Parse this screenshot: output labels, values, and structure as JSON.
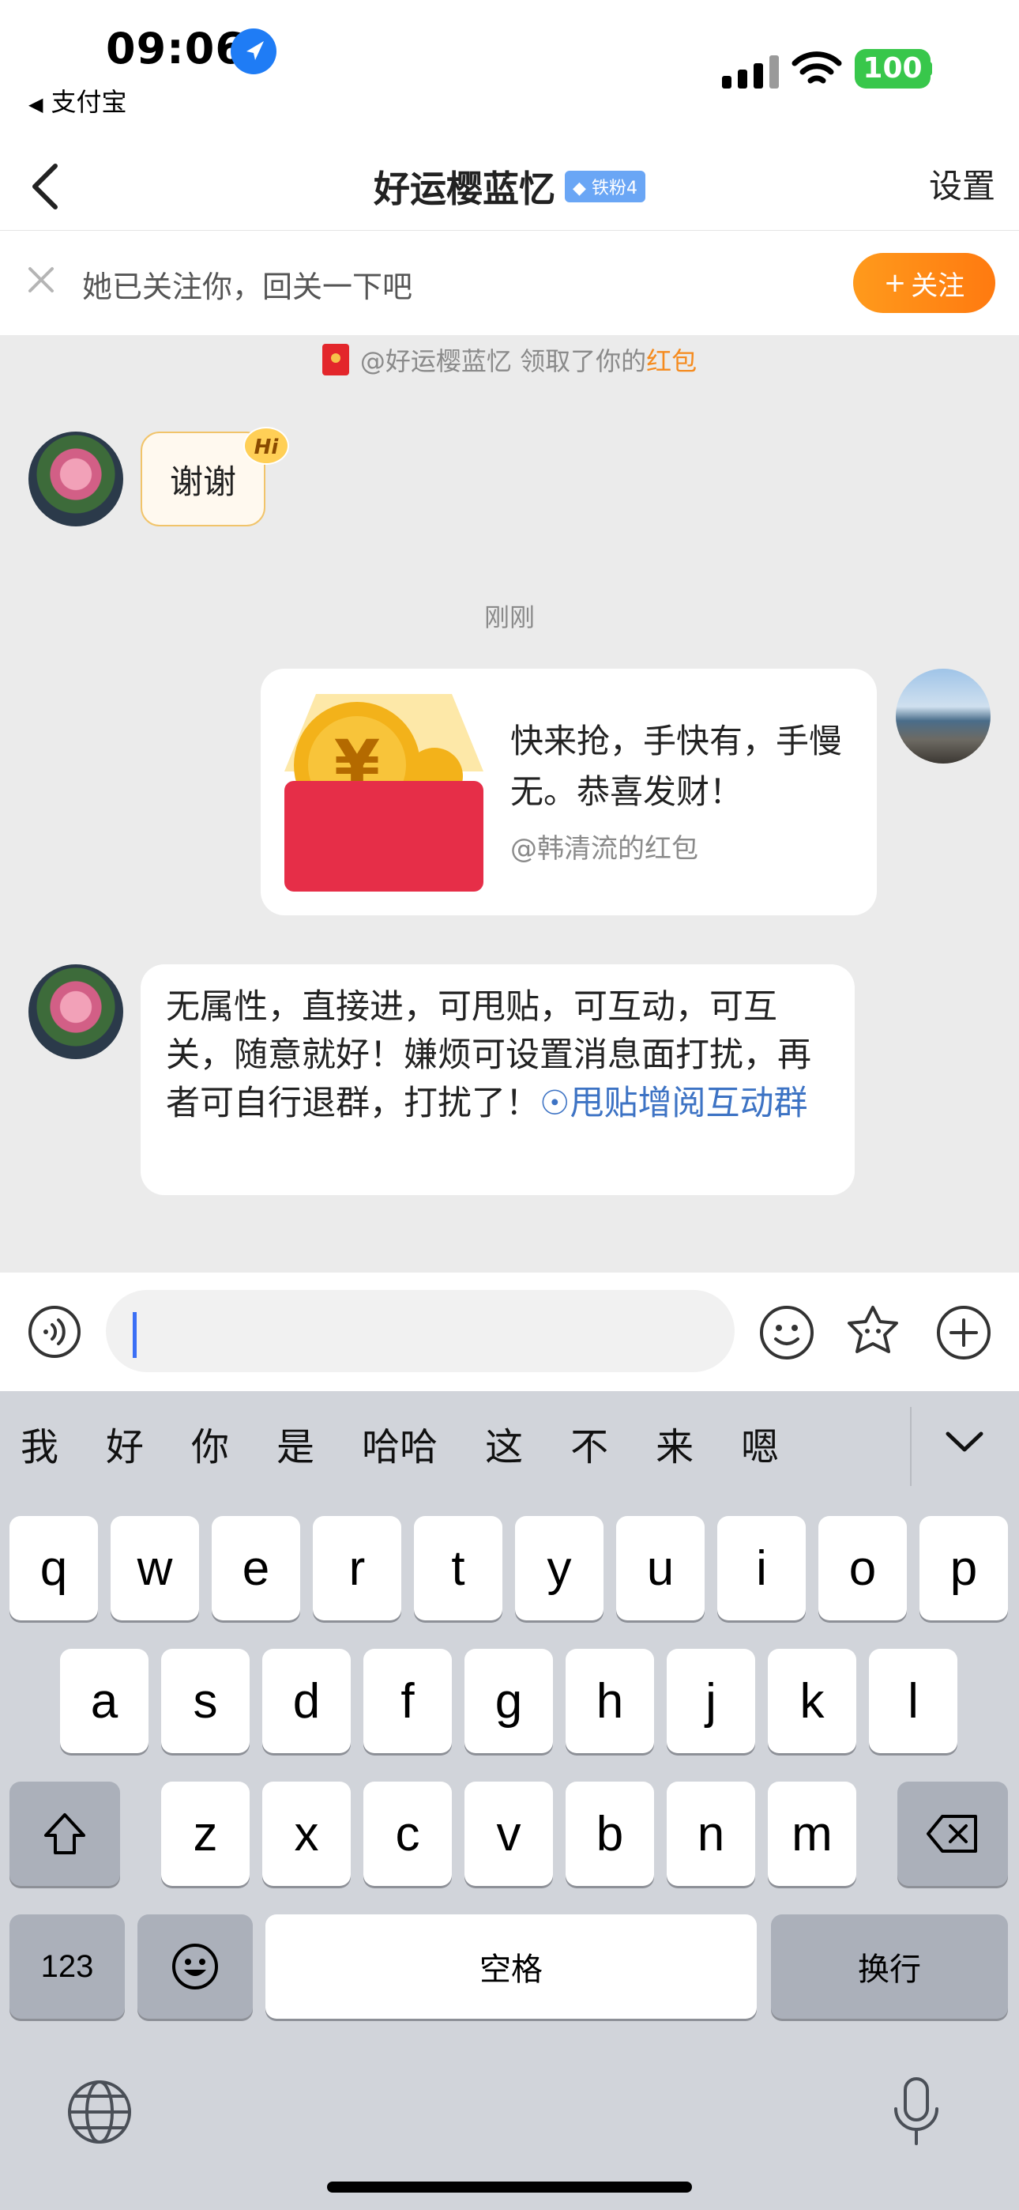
{
  "status_bar": {
    "time": "09:06",
    "back_app": "支付宝",
    "battery": "100"
  },
  "nav": {
    "title": "好运樱蓝忆",
    "fan_badge": "铁粉4",
    "settings": "设置"
  },
  "follow_bar": {
    "text": "她已关注你，回关一下吧",
    "button": "关注",
    "button_plus": "+"
  },
  "notice": {
    "prefix": "@好运樱蓝忆 领取了你的",
    "link": "红包"
  },
  "messages": {
    "thanks": "谢谢",
    "hi_badge": "Hi",
    "timestamp": "刚刚",
    "redpacket_text": "快来抢，手快有，手慢无。恭喜发财！",
    "redpacket_sender": "@韩清流的红包",
    "long_text": "无属性，直接进，可甩贴，可互动，可互关，随意就好！嫌烦可设置消息面打扰，再者可自行退群，打扰了！",
    "long_link": "甩贴增阅互动群"
  },
  "keyboard": {
    "suggestions": [
      "我",
      "好",
      "你",
      "是",
      "哈哈",
      "这",
      "不",
      "来",
      "嗯"
    ],
    "row1": [
      "q",
      "w",
      "e",
      "r",
      "t",
      "y",
      "u",
      "i",
      "o",
      "p"
    ],
    "row2": [
      "a",
      "s",
      "d",
      "f",
      "g",
      "h",
      "j",
      "k",
      "l"
    ],
    "row3": [
      "z",
      "x",
      "c",
      "v",
      "b",
      "n",
      "m"
    ],
    "numbers_key": "123",
    "space_key": "空格",
    "return_key": "换行"
  },
  "colors": {
    "accent_orange": "#ff8a17",
    "link_blue": "#3d73c4",
    "battery_green": "#38c74b"
  }
}
